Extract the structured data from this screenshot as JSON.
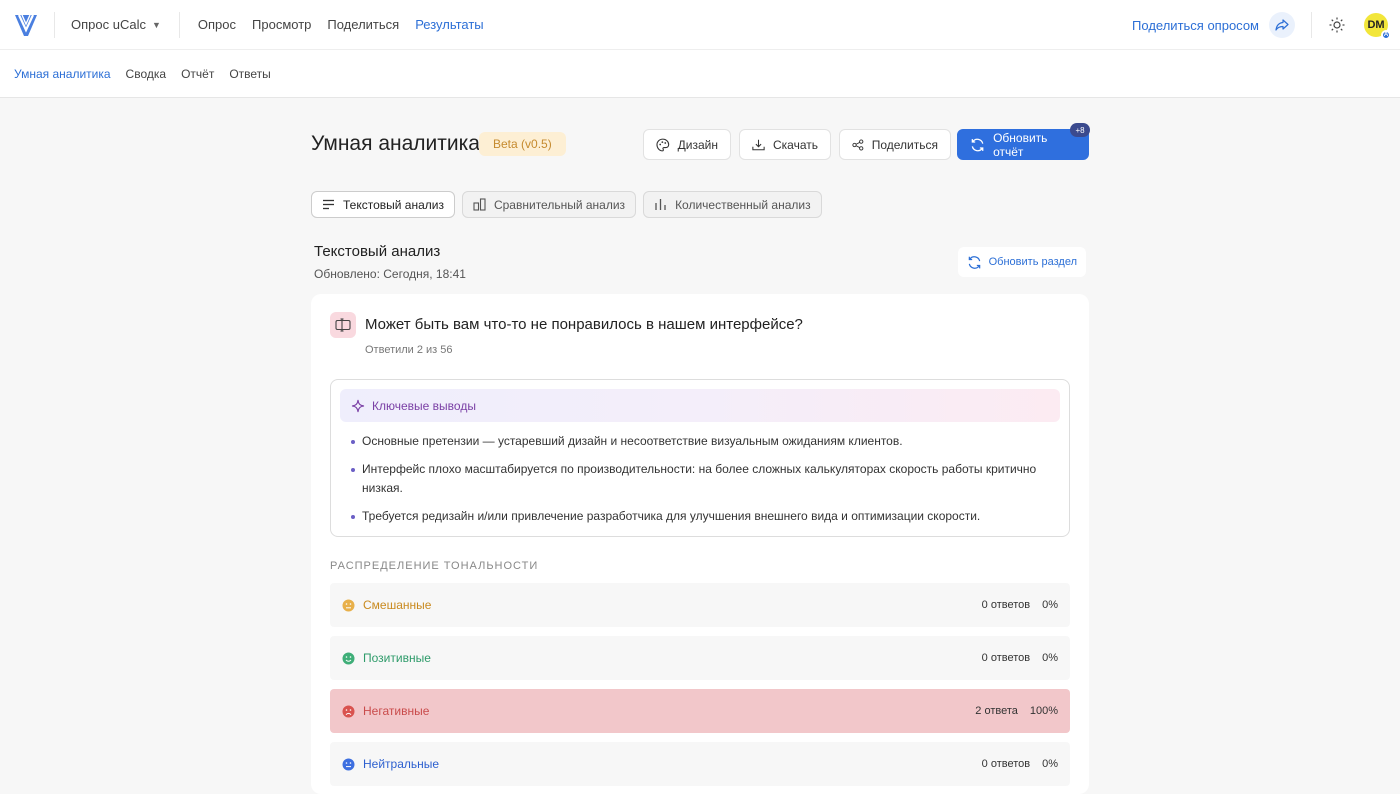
{
  "topbar": {
    "survey_name": "Опрос uCalc",
    "nav": [
      "Опрос",
      "Просмотр",
      "Поделиться",
      "Результаты"
    ],
    "active_nav": "Результаты",
    "share_survey": "Поделиться опросом",
    "avatar_initials": "DM",
    "avatar_badge": "A"
  },
  "subnav": {
    "items": [
      "Умная аналитика",
      "Сводка",
      "Отчёт",
      "Ответы"
    ],
    "active": "Умная аналитика"
  },
  "header": {
    "title": "Умная аналитика",
    "beta": "Beta (v0.5)",
    "design": "Дизайн",
    "download": "Скачать",
    "share": "Поделиться",
    "refresh": "Обновить отчёт",
    "refresh_badge": "+8"
  },
  "tabs": [
    "Текстовый анализ",
    "Сравнительный анализ",
    "Количественный анализ"
  ],
  "section": {
    "title": "Текстовый анализ",
    "updated": "Обновлено: Сегодня, 18:41",
    "refresh_section": "Обновить раздел"
  },
  "question": {
    "text": "Может быть вам что-то не понравилось в нашем интерфейсе?",
    "answered": "Ответили 2 из 56"
  },
  "insights": {
    "title": "Ключевые выводы",
    "items": [
      "Основные претензии — устаревший дизайн и несоответствие визуальным ожиданиям клиентов.",
      "Интерфейс плохо масштабируется по производительности: на более сложных калькуляторах скорость работы критично низкая.",
      "Требуется редизайн и/или привлечение разработчика для улучшения внешнего вида и оптимизации скорости."
    ]
  },
  "sentiment": {
    "label": "РАСПРЕДЕЛЕНИЕ ТОНАЛЬНОСТИ",
    "rows": [
      {
        "name": "Смешанные",
        "count": "0 ответов",
        "pct": "0%",
        "color": "#c98a1f",
        "icon_color": "#e8b04a"
      },
      {
        "name": "Позитивные",
        "count": "0 ответов",
        "pct": "0%",
        "color": "#2e9b6a",
        "icon_color": "#3fae78"
      },
      {
        "name": "Негативные",
        "count": "2 ответа",
        "pct": "100%",
        "color": "#c94b4b",
        "icon_color": "#d9534f"
      },
      {
        "name": "Нейтральные",
        "count": "0 ответов",
        "pct": "0%",
        "color": "#2c5fcf",
        "icon_color": "#3d6fe0"
      }
    ]
  }
}
